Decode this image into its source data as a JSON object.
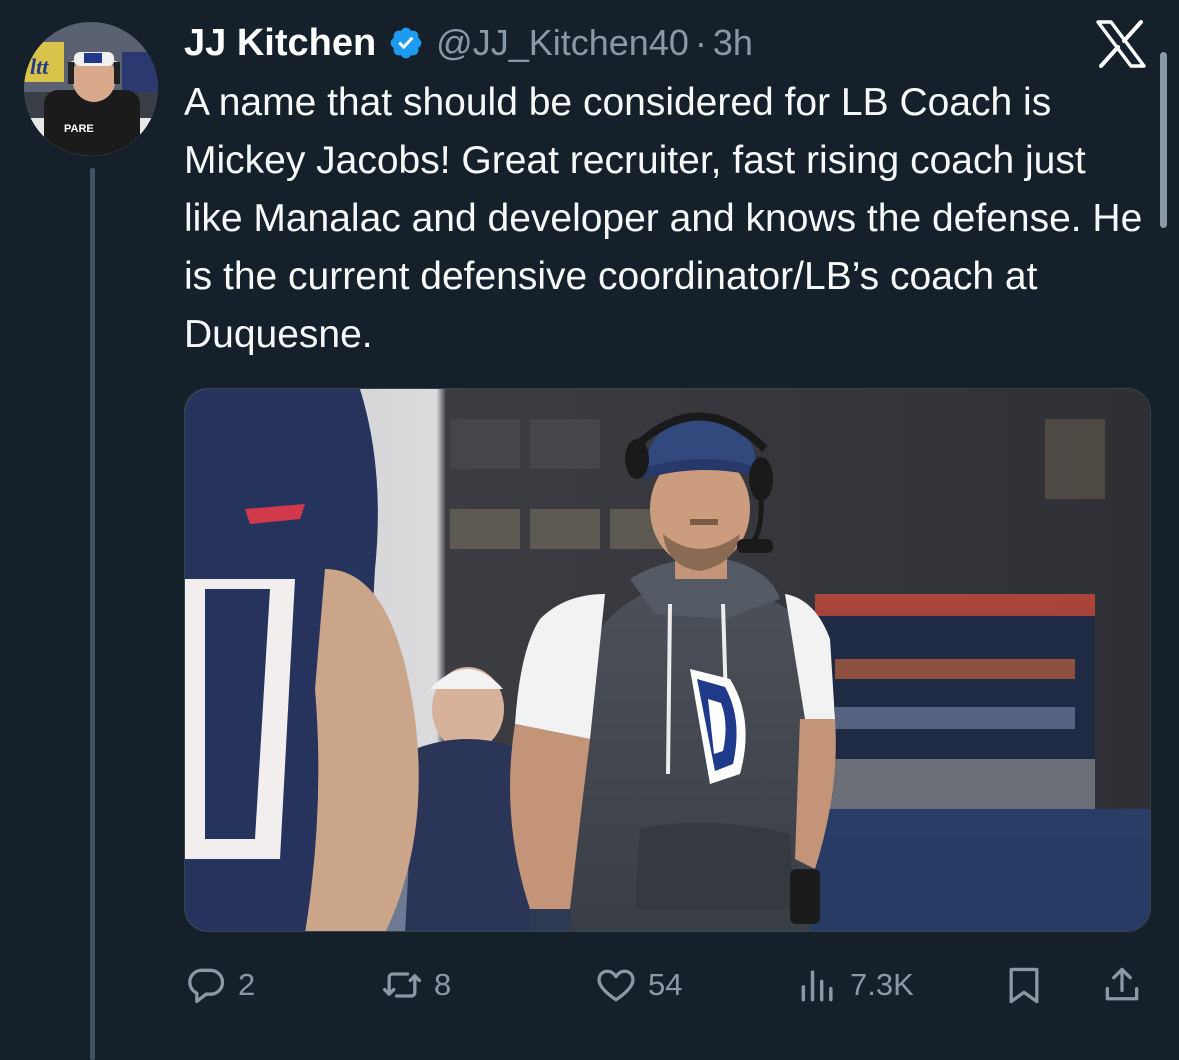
{
  "tweet": {
    "author_name": "JJ Kitchen",
    "handle": "@JJ_Kitchen40",
    "separator": "·",
    "time": "3h",
    "text": "A name that should be considered for LB Coach is Mickey Jacobs! Great recruiter, fast rising coach just like Manalac and developer and knows the defense. He is the current defensive coordinator/LB’s coach at Duquesne.",
    "verified": true
  },
  "avatar": {
    "hat_logo_text": "ltt",
    "shirt_text": "PARE"
  },
  "actions": {
    "replies": "2",
    "reposts": "8",
    "likes": "54",
    "views": "7.3K"
  },
  "icons": {
    "verified": "verified-badge-icon",
    "brand": "x-logo-icon",
    "reply": "reply-icon",
    "repost": "repost-icon",
    "like": "heart-icon",
    "views": "views-icon",
    "bookmark": "bookmark-icon",
    "share": "share-icon"
  },
  "colors": {
    "background": "#15202b",
    "muted": "#8b98a5",
    "verified_blue": "#1d9bf0",
    "thread_line": "#425364"
  }
}
